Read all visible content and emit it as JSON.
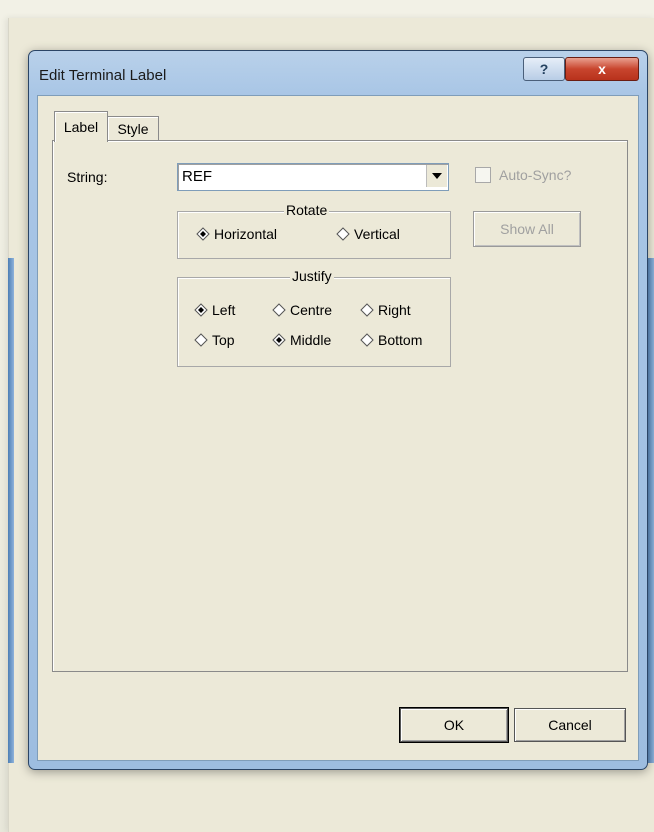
{
  "window": {
    "title": "Edit Terminal Label",
    "help_button": "?",
    "close_button": "x"
  },
  "tabs": [
    {
      "label": "Label",
      "active": true
    },
    {
      "label": "Style",
      "active": false
    }
  ],
  "form": {
    "string_label": "String:",
    "string_value": "REF",
    "auto_sync_label": "Auto-Sync?",
    "auto_sync_checked": false,
    "auto_sync_enabled": false,
    "show_all_label": "Show All",
    "show_all_enabled": false
  },
  "rotate": {
    "title": "Rotate",
    "options": [
      {
        "label": "Horizontal",
        "selected": true
      },
      {
        "label": "Vertical",
        "selected": false
      }
    ]
  },
  "justify": {
    "title": "Justify",
    "options": [
      {
        "label": "Left",
        "selected": true
      },
      {
        "label": "Centre",
        "selected": false
      },
      {
        "label": "Right",
        "selected": false
      },
      {
        "label": "Top",
        "selected": false
      },
      {
        "label": "Middle",
        "selected": true
      },
      {
        "label": "Bottom",
        "selected": false
      }
    ]
  },
  "buttons": {
    "ok_label": "OK",
    "cancel_label": "Cancel"
  },
  "colors": {
    "dialog_face": "#ece9d8",
    "titlebar": "#a9c6e6",
    "close_button": "#c8452e",
    "disabled_text": "#a0a0a0"
  }
}
